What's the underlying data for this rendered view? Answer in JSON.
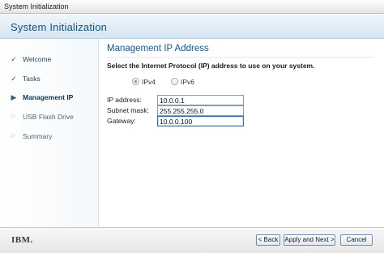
{
  "window": {
    "title": "System Initialization"
  },
  "header": {
    "title": "System Initialization"
  },
  "sidebar": {
    "steps": [
      {
        "label": "Welcome",
        "state": "done",
        "mark": "✓"
      },
      {
        "label": "Tasks",
        "state": "done",
        "mark": "✓"
      },
      {
        "label": "Management IP",
        "state": "current",
        "mark": "▶"
      },
      {
        "label": "USB Flash Drive",
        "state": "pending",
        "mark": "▷"
      },
      {
        "label": "Summary",
        "state": "pending",
        "mark": "▷"
      }
    ]
  },
  "main": {
    "heading": "Management IP Address",
    "prompt": "Select the Internet Protocol (IP) address to use on your system.",
    "protocol": {
      "options": [
        {
          "label": "IPv4",
          "selected": true
        },
        {
          "label": "IPv6",
          "selected": false
        }
      ]
    },
    "fields": [
      {
        "label": "IP address:",
        "value": "10.0.0.1"
      },
      {
        "label": "Subnet mask:",
        "value": "255.255.255.0"
      },
      {
        "label": "Gateway:",
        "value": "10.0.0.100"
      }
    ]
  },
  "footer": {
    "logo": "IBM.",
    "back_label": "< Back",
    "next_label": "Apply and Next >",
    "cancel_label": "Cancel"
  }
}
